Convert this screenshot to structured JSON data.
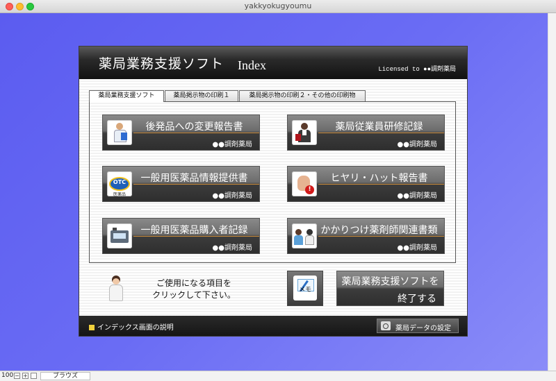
{
  "window": {
    "title": "yakkyokugyoumu"
  },
  "header": {
    "title": "薬局業務支援ソフト",
    "index": "Index",
    "license": "Licensed to ●●調剤薬局"
  },
  "tabs": [
    {
      "label": "薬局業務支援ソフト"
    },
    {
      "label": "薬局掲示物の印刷１"
    },
    {
      "label": "薬局掲示物の印刷２・その他の印刷物"
    }
  ],
  "menu": [
    {
      "label": "後発品への変更報告書",
      "sub": "●●調剤薬局",
      "icon": "pharmacist-icon"
    },
    {
      "label": "薬局従業員研修記録",
      "sub": "●●調剤薬局",
      "icon": "staff-icon"
    },
    {
      "label": "一般用医薬品情報提供書",
      "sub": "●●調剤薬局",
      "icon": "otc-icon",
      "icon_text": "OTC",
      "icon_subtext": "医薬品"
    },
    {
      "label": "ヒヤリ・ハット報告書",
      "sub": "●●調剤薬局",
      "icon": "hand-warning-icon",
      "icon_text": "!"
    },
    {
      "label": "一般用医薬品購入者記録",
      "sub": "●●調剤薬局",
      "icon": "register-icon"
    },
    {
      "label": "かかりつけ薬剤師関連書類",
      "sub": "●●調剤薬局",
      "icon": "consultation-icon"
    }
  ],
  "instructions": {
    "line1": "ご使用になる項目を",
    "line2": "クリックして下さい。"
  },
  "memo": {
    "label": "メモ"
  },
  "quit": {
    "line1": "薬局業務支援ソフトを",
    "line2": "終了する"
  },
  "footer": {
    "help": "インデックス画面の説明",
    "settings": "薬局データの設定"
  },
  "statusbar": {
    "zoom": "100",
    "mode": "ブラウズ"
  },
  "colors": {
    "desktop": "#6a6cf4",
    "accent_line": "#c88a3a",
    "help_square": "#f1d13c"
  }
}
